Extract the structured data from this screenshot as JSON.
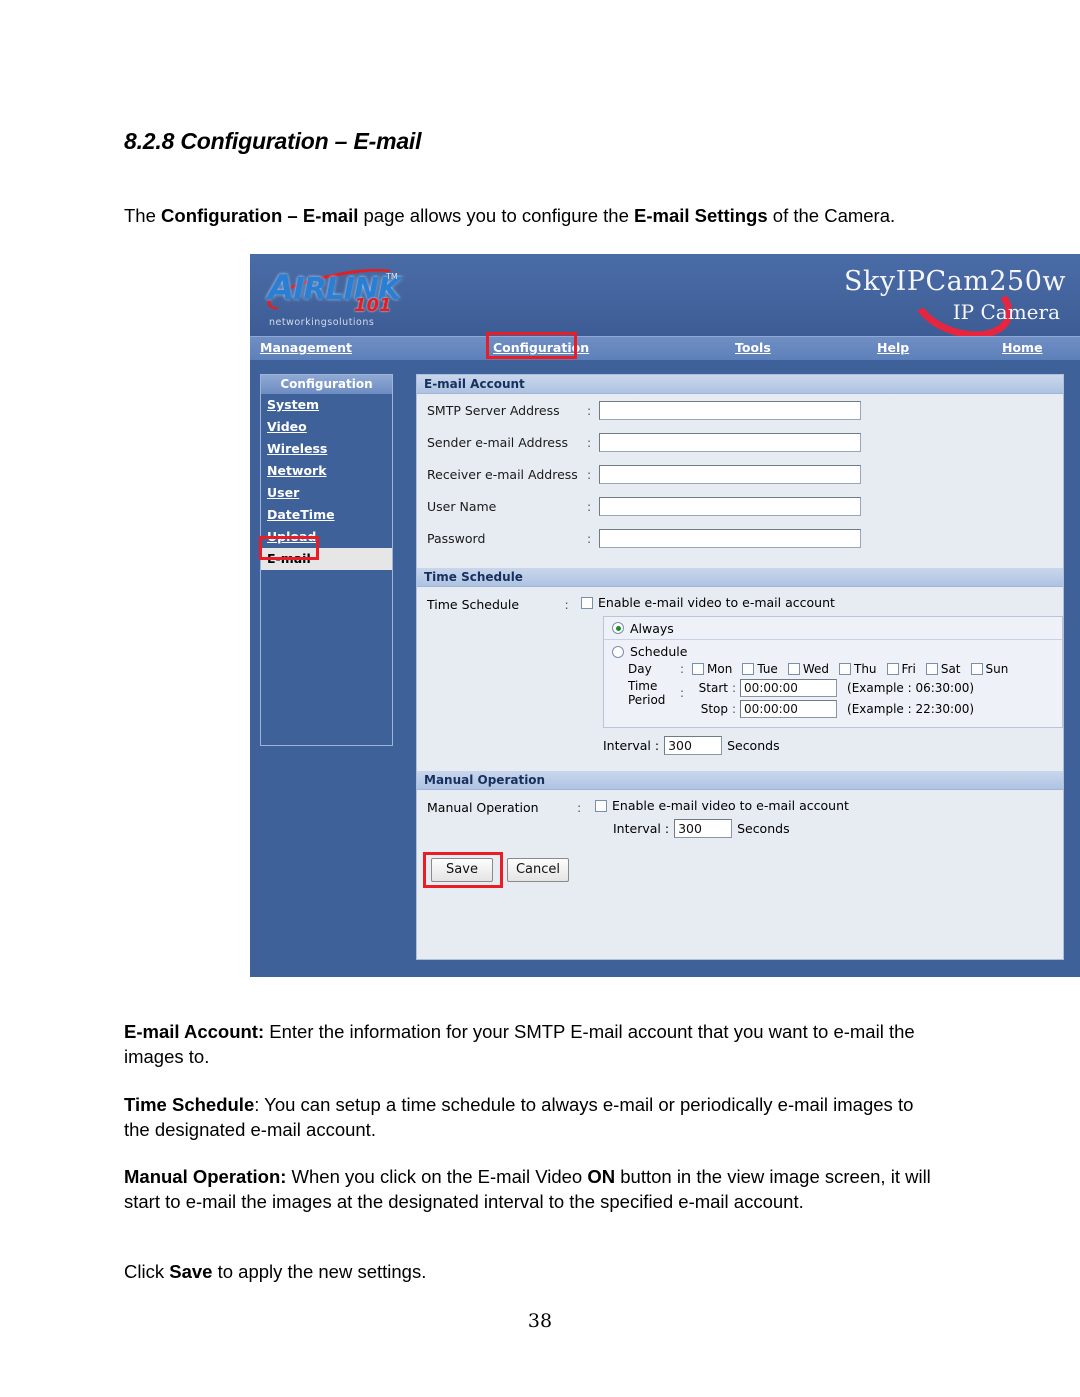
{
  "document": {
    "heading": "8.2.8 Configuration – E-mail",
    "intro": {
      "p1": "The ",
      "b1": "Configuration – E-mail",
      "p2": " page allows you to configure the ",
      "b2": "E-mail Settings",
      "p3": " of the Camera."
    },
    "paragraphs": {
      "email_account": {
        "label": "E-mail Account:",
        "text": " Enter the information for your SMTP E-mail account that you want to e-mail the images to."
      },
      "time_schedule": {
        "label": "Time Schedule",
        "text": ": You can setup a time schedule to always e-mail or periodically e-mail images to the designated e-mail account."
      },
      "manual_operation": {
        "label": "Manual Operation:",
        "text1": " When you click on the E-mail Video ",
        "bold_on": "ON",
        "text2": " button in the view image screen, it will start to e-mail the images at the designated interval to the specified e-mail account."
      },
      "click_save": {
        "text1": "Click ",
        "bold": "Save",
        "text2": " to apply the new settings."
      }
    },
    "page_number": "38"
  },
  "screenshot": {
    "logo": {
      "brand_air": "A",
      "brand_rest": "IRLINK",
      "tm": "TM",
      "number": "101",
      "tagline": "networkingsolutions"
    },
    "product": {
      "model": "SkyIPCam250w",
      "subtitle": "IP Camera"
    },
    "topnav": {
      "items": [
        {
          "label": "Management",
          "key": "management",
          "active": false
        },
        {
          "label": "Configuration",
          "key": "configuration",
          "active": true
        },
        {
          "label": "Tools",
          "key": "tools",
          "active": false
        },
        {
          "label": "Help",
          "key": "help",
          "active": false
        },
        {
          "label": "Home",
          "key": "home",
          "active": false
        }
      ]
    },
    "sidebar": {
      "title": "Configuration",
      "items": [
        {
          "label": "System",
          "active": false
        },
        {
          "label": "Video",
          "active": false
        },
        {
          "label": "Wireless",
          "active": false
        },
        {
          "label": "Network",
          "active": false
        },
        {
          "label": "User",
          "active": false
        },
        {
          "label": "DateTime",
          "active": false
        },
        {
          "label": "Upload",
          "active": false
        },
        {
          "label": "E-mail",
          "active": true
        }
      ]
    },
    "email_account": {
      "header": "E-mail Account",
      "fields": [
        {
          "label": "SMTP Server Address",
          "value": ""
        },
        {
          "label": "Sender e-mail Address",
          "value": ""
        },
        {
          "label": "Receiver e-mail Address",
          "value": ""
        },
        {
          "label": "User Name",
          "value": ""
        },
        {
          "label": "Password",
          "value": ""
        }
      ],
      "colon": ":"
    },
    "time_schedule": {
      "header": "Time Schedule",
      "row_label": "Time Schedule",
      "colon": ":",
      "enable_label": "Enable e-mail video to e-mail account",
      "enable_checked": false,
      "mode_always": {
        "label": "Always",
        "selected": true
      },
      "mode_schedule": {
        "label": "Schedule",
        "selected": false
      },
      "day_label": "Day",
      "days": [
        {
          "label": "Mon",
          "checked": false
        },
        {
          "label": "Tue",
          "checked": false
        },
        {
          "label": "Wed",
          "checked": false
        },
        {
          "label": "Thu",
          "checked": false
        },
        {
          "label": "Fri",
          "checked": false
        },
        {
          "label": "Sat",
          "checked": false
        },
        {
          "label": "Sun",
          "checked": false
        }
      ],
      "time_period_label_line1": "Time",
      "time_period_label_line2": "Period",
      "start": {
        "label": "Start",
        "value": "00:00:00",
        "example": "(Example : 06:30:00)"
      },
      "stop": {
        "label": "Stop",
        "value": "00:00:00",
        "example": "(Example : 22:30:00)"
      },
      "interval": {
        "label": "Interval :",
        "value": "300",
        "unit": "Seconds"
      }
    },
    "manual_operation": {
      "header": "Manual Operation",
      "row_label": "Manual Operation",
      "colon": ":",
      "enable_label": "Enable e-mail video to e-mail account",
      "enable_checked": false,
      "interval": {
        "label": "Interval :",
        "value": "300",
        "unit": "Seconds"
      }
    },
    "buttons": {
      "save": "Save",
      "cancel": "Cancel"
    },
    "colors": {
      "chrome_blue": "#3f6199",
      "nav_blue": "#5e80ba",
      "panel_bg": "#e7ecf3",
      "section_header": "#aec3e2",
      "highlight_red": "#ec1c24",
      "logo_red": "#e02020",
      "logo_blue": "#2a7fd4"
    }
  }
}
